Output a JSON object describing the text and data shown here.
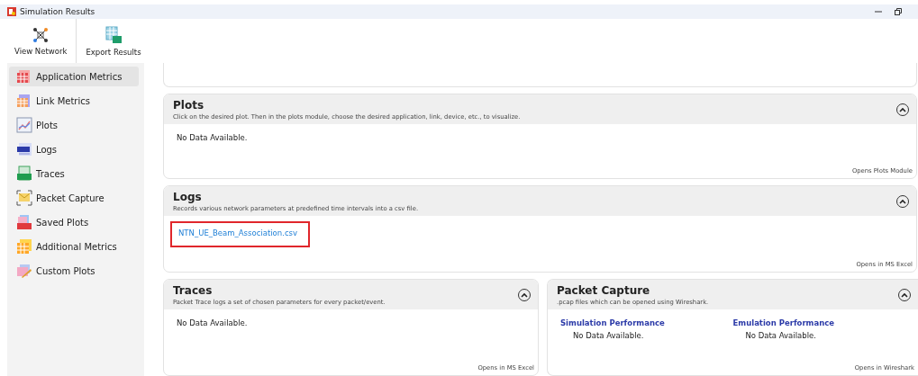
{
  "window": {
    "title": "Simulation Results"
  },
  "toolbar": [
    {
      "kind": "network",
      "label": "View Network"
    },
    {
      "kind": "excel",
      "label": "Export Results"
    }
  ],
  "sidebar": {
    "items": [
      {
        "kind": "app",
        "label": "Application Metrics",
        "selected": true
      },
      {
        "kind": "link",
        "label": "Link Metrics",
        "selected": false
      },
      {
        "kind": "plots",
        "label": "Plots",
        "selected": false
      },
      {
        "kind": "logs",
        "label": "Logs",
        "selected": false
      },
      {
        "kind": "traces",
        "label": "Traces",
        "selected": false
      },
      {
        "kind": "capture",
        "label": "Packet Capture",
        "selected": false
      },
      {
        "kind": "saved",
        "label": "Saved Plots",
        "selected": false
      },
      {
        "kind": "additional",
        "label": "Additional Metrics",
        "selected": false
      },
      {
        "kind": "custom",
        "label": "Custom Plots",
        "selected": false
      }
    ]
  },
  "plots": {
    "title": "Plots",
    "description": "Click on the desired plot. Then in the plots module, choose the desired application, link, device, etc., to visualize.",
    "expanded": true,
    "empty_text": "No Data Available.",
    "footer": "Opens Plots Module"
  },
  "logs": {
    "title": "Logs",
    "description": "Records various network parameters at predefined time intervals into a csv file.",
    "expanded": true,
    "files": [
      {
        "name": "NTN_UE_Beam_Association.csv",
        "highlighted": true
      }
    ],
    "footer": "Opens in MS Excel"
  },
  "traces": {
    "title": "Traces",
    "description": "Packet Trace logs a set of chosen parameters for every packet/event.",
    "expanded": true,
    "empty_text": "No Data Available.",
    "footer": "Opens in MS Excel"
  },
  "packet_capture": {
    "title": "Packet Capture",
    "description": ".pcap files which can be opened using Wireshark.",
    "expanded": true,
    "columns": [
      {
        "heading": "Simulation Performance",
        "empty_text": "No Data Available."
      },
      {
        "heading": "Emulation Performance",
        "empty_text": "No Data Available."
      }
    ],
    "footer": "Opens in Wireshark"
  }
}
